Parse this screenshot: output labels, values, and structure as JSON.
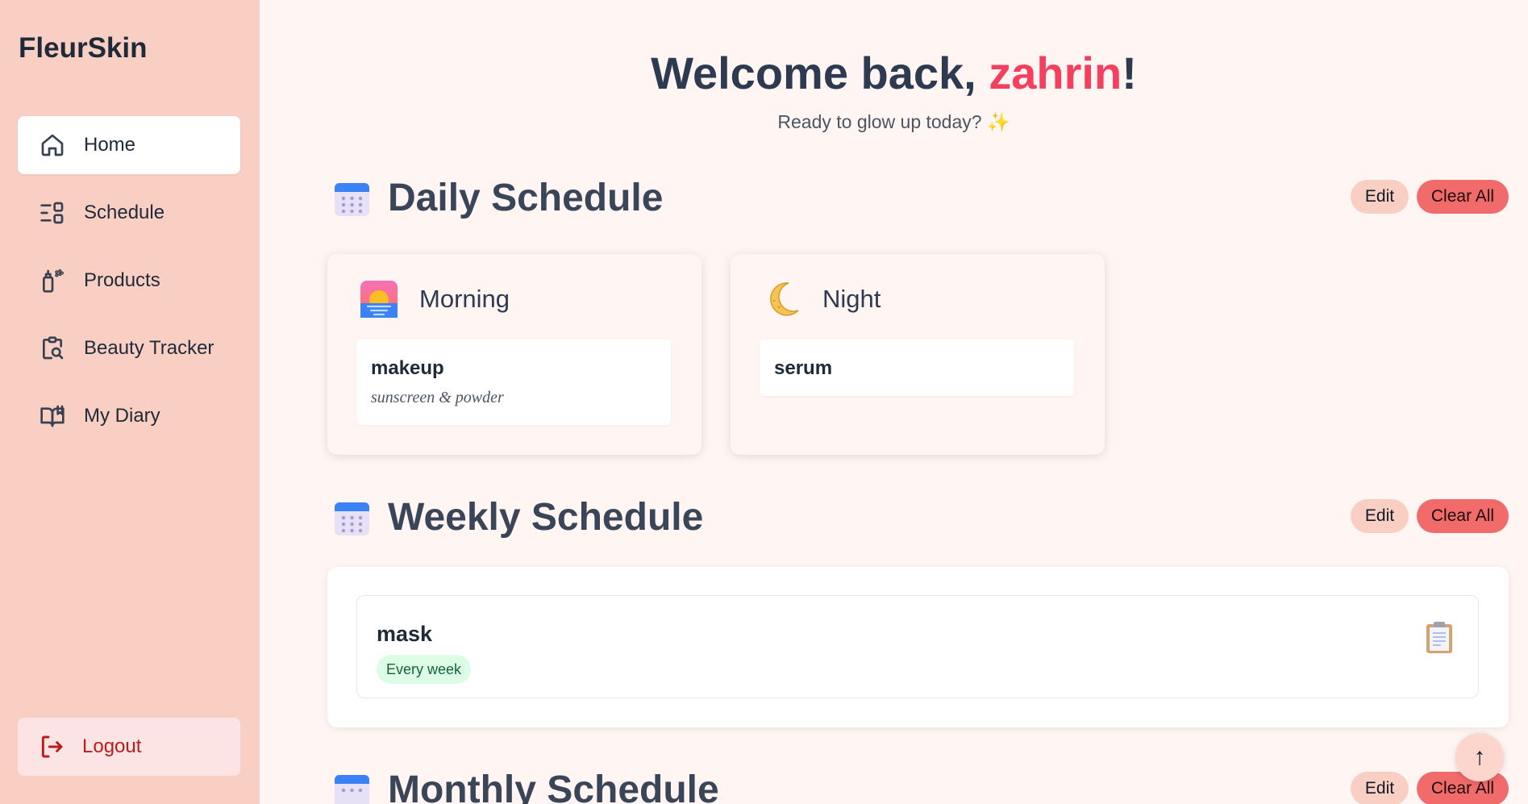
{
  "app": {
    "name": "FleurSkin"
  },
  "sidebar": {
    "items": [
      {
        "label": "Home",
        "icon": "home-icon",
        "active": true
      },
      {
        "label": "Schedule",
        "icon": "schedule-icon"
      },
      {
        "label": "Products",
        "icon": "products-icon"
      },
      {
        "label": "Beauty Tracker",
        "icon": "beauty-tracker-icon"
      },
      {
        "label": "My Diary",
        "icon": "diary-book-icon"
      }
    ],
    "logout": "Logout"
  },
  "header": {
    "greeting": "Welcome back, ",
    "username": "zahrin",
    "exclaim": "!",
    "subtitle": "Ready to glow up today? ✨"
  },
  "daily": {
    "title": "Daily Schedule",
    "edit": "Edit",
    "clear": "Clear All",
    "morning": {
      "label": "Morning",
      "items": [
        {
          "name": "makeup",
          "note": "sunscreen & powder"
        }
      ]
    },
    "night": {
      "label": "Night",
      "items": [
        {
          "name": "serum"
        }
      ]
    }
  },
  "weekly": {
    "title": "Weekly Schedule",
    "edit": "Edit",
    "clear": "Clear All",
    "items": [
      {
        "name": "mask",
        "frequency": "Every week"
      }
    ]
  },
  "monthly": {
    "title": "Monthly Schedule",
    "edit": "Edit",
    "clear": "Clear All"
  },
  "fab": {
    "label": "↑"
  },
  "colors": {
    "accent": "#f43f5e",
    "sidebar": "#f9cfc4",
    "clear": "#f26b6b",
    "badge": "#dcfce7"
  }
}
